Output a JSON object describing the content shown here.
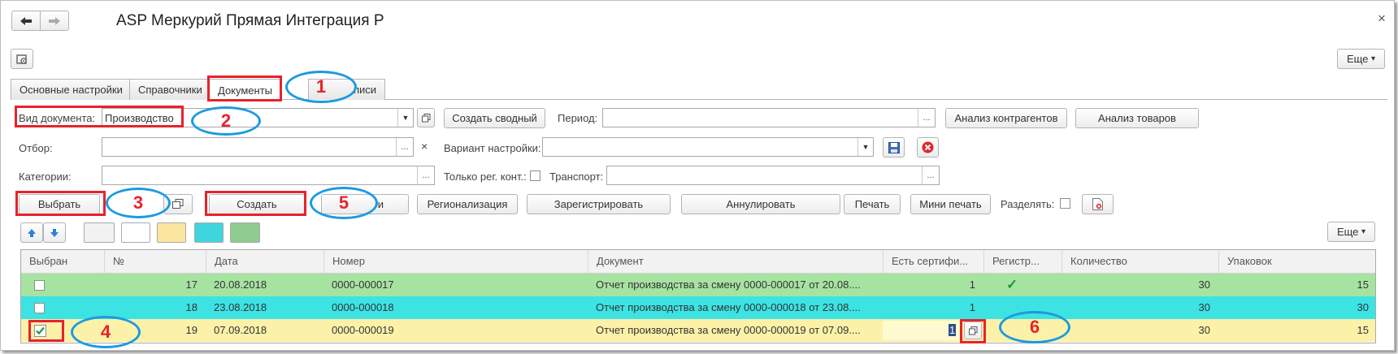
{
  "window": {
    "title": "ASP Меркурий Прямая Интеграция Р",
    "close": "×",
    "back_icon": "arrow-left-icon",
    "forward_icon": "arrow-right-icon"
  },
  "toolbar": {
    "more_label": "Еще",
    "more_arrow": "▾"
  },
  "tabs": [
    {
      "label": "Основные настройки"
    },
    {
      "label": "Справочники"
    },
    {
      "label": "Документы"
    },
    {
      "label": "писи"
    }
  ],
  "filters": {
    "doc_type_label": "Вид документа:",
    "doc_type_value": "Производство",
    "create_summary": "Создать сводный",
    "period_label": "Период:",
    "counterparty_analysis": "Анализ контрагентов",
    "goods_analysis": "Анализ товаров",
    "selection_label": "Отбор:",
    "variant_label": "Вариант настройки:",
    "categories_label": "Категории:",
    "reg_only_label": "Только рег. конт.:",
    "transport_label": "Транспорт:",
    "dots": "...",
    "clear": "×"
  },
  "actions": {
    "select": "Выбрать",
    "create": "Создать",
    "hidden_tail": "и",
    "regionalization": "Регионализация",
    "register": "Зарегистрировать",
    "annul": "Аннулировать",
    "print": "Печать",
    "mini_print": "Мини печать",
    "split_label": "Разделять:"
  },
  "colors": {
    "green_row": "#a6e3a1",
    "cyan_row": "#3de3e3",
    "yellow_row": "#fcf1a8",
    "swatch_white1": "#f2f2f2",
    "swatch_white2": "#ffffff",
    "swatch_yellow": "#fbe6a0",
    "swatch_cyan": "#3dd6dc",
    "swatch_green": "#8fcc8f",
    "annotation_red": "#e8222b",
    "annotation_blue": "#1a9be0"
  },
  "grid": {
    "more_label": "Еще",
    "columns": [
      "Выбран",
      "№",
      "Дата",
      "Номер",
      "Документ",
      "Есть сертифи...",
      "Регистр...",
      "Количество",
      "Упаковок"
    ],
    "rows": [
      {
        "num": "17",
        "date": "20.08.2018",
        "number": "0000-000017",
        "doc": "Отчет производства за смену 0000-000017 от 20.08....",
        "cert": "1",
        "reg": "✓",
        "qty": "30",
        "pack": "15"
      },
      {
        "num": "18",
        "date": "23.08.2018",
        "number": "0000-000018",
        "doc": "Отчет производства за смену 0000-000018 от 23.08....",
        "cert": "1",
        "reg": "",
        "qty": "30",
        "pack": "30"
      },
      {
        "num": "19",
        "date": "07.09.2018",
        "number": "0000-000019",
        "doc": "Отчет производства за смену 0000-000019 от 07.09....",
        "cert": "1",
        "reg": "",
        "qty": "30",
        "pack": "15"
      }
    ]
  },
  "annotations": [
    "1",
    "2",
    "3",
    "4",
    "5",
    "6"
  ]
}
